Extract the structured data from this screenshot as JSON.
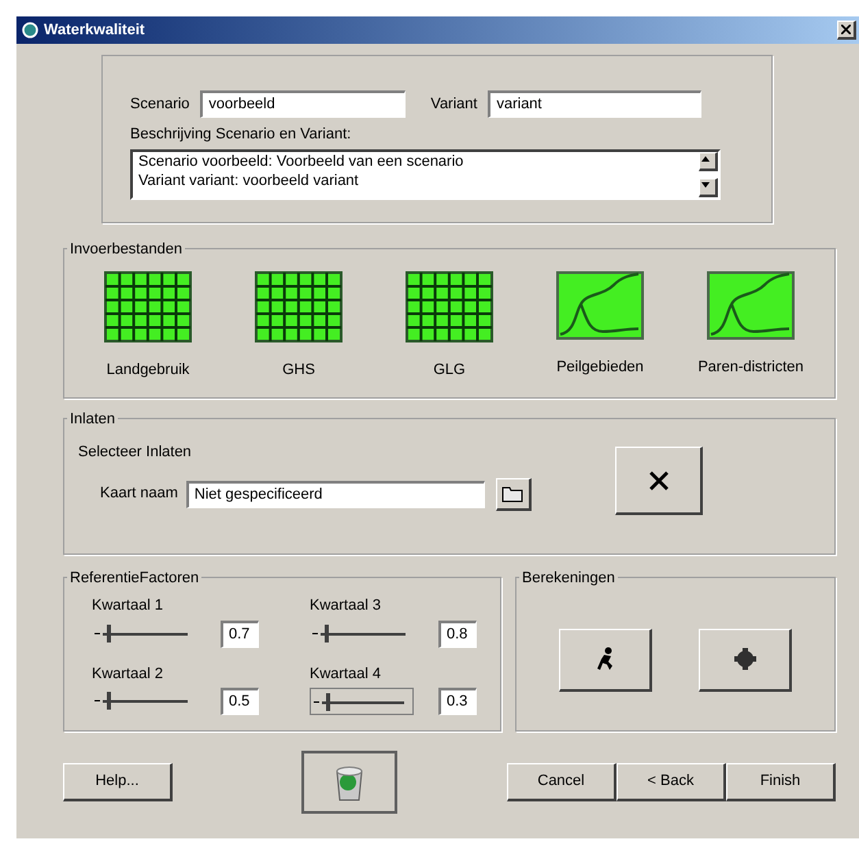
{
  "window": {
    "title": "Waterkwaliteit"
  },
  "scenario": {
    "label": "Scenario",
    "value": "voorbeeld"
  },
  "variant": {
    "label": "Variant",
    "value": "variant"
  },
  "description": {
    "label": "Beschrijving Scenario en Variant:",
    "lines": [
      "Scenario voorbeeld: Voorbeeld van een scenario",
      "Variant variant: voorbeeld variant"
    ]
  },
  "input_files": {
    "title": "Invoerbestanden",
    "items": [
      {
        "label": "Landgebruik",
        "kind": "grid"
      },
      {
        "label": "GHS",
        "kind": "grid"
      },
      {
        "label": "GLG",
        "kind": "grid"
      },
      {
        "label": "Peilgebieden",
        "kind": "curve"
      },
      {
        "label": "Paren-districten",
        "kind": "curve"
      }
    ]
  },
  "inlets": {
    "title": "Inlaten",
    "subtitle": "Selecteer Inlaten",
    "map_label": "Kaart naam",
    "map_value": "Niet gespecificeerd"
  },
  "factors": {
    "title": "ReferentieFactoren",
    "sliders": [
      {
        "label": "Kwartaal 1",
        "level": 0.15,
        "reading": "0.7",
        "focused": false
      },
      {
        "label": "Kwartaal 3",
        "level": 0.15,
        "reading": "0.8",
        "focused": false
      },
      {
        "label": "Kwartaal 2",
        "level": 0.15,
        "reading": "0.5",
        "focused": false
      },
      {
        "label": "Kwartaal 4",
        "level": 0.15,
        "reading": "0.3",
        "focused": true
      }
    ]
  },
  "calculations": {
    "title": "Berekeningen"
  },
  "buttons": {
    "help": "Help...",
    "cancel": "Cancel",
    "back": "< Back",
    "finish": "Finish"
  }
}
